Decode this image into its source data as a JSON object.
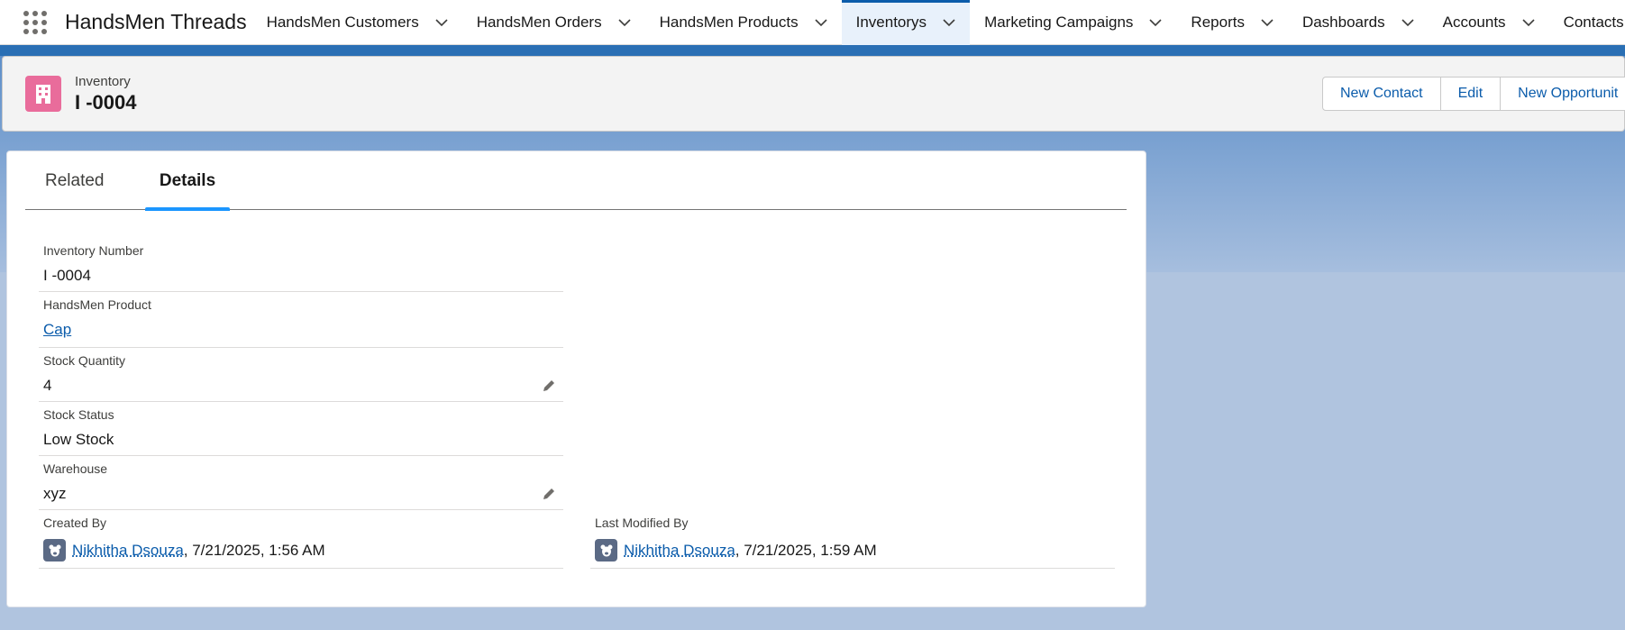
{
  "app": {
    "name": "HandsMen Threads"
  },
  "nav": {
    "items": [
      {
        "label": "HandsMen Customers"
      },
      {
        "label": "HandsMen Orders"
      },
      {
        "label": "HandsMen Products"
      },
      {
        "label": "Inventorys",
        "active": true
      },
      {
        "label": "Marketing Campaigns"
      },
      {
        "label": "Reports"
      },
      {
        "label": "Dashboards"
      },
      {
        "label": "Accounts"
      },
      {
        "label": "Contacts"
      }
    ]
  },
  "header": {
    "object_label": "Inventory",
    "record_title": "I -0004",
    "icon": "building-icon",
    "icon_color": "#e96c9b",
    "actions": [
      "New Contact",
      "Edit",
      "New Opportunit"
    ]
  },
  "tabs": [
    {
      "label": "Related"
    },
    {
      "label": "Details",
      "active": true
    }
  ],
  "details": {
    "inventory_number": {
      "label": "Inventory Number",
      "value": "I -0004"
    },
    "product": {
      "label": "HandsMen Product",
      "value": "Cap"
    },
    "stock_quantity": {
      "label": "Stock Quantity",
      "value": "4"
    },
    "stock_status": {
      "label": "Stock Status",
      "value": "Low Stock"
    },
    "warehouse": {
      "label": "Warehouse",
      "value": "xyz"
    },
    "created_by": {
      "label": "Created By",
      "user": "Nikhitha Dsouza",
      "date": ", 7/21/2025, 1:56 AM"
    },
    "last_modified_by": {
      "label": "Last Modified By",
      "user": "Nikhitha Dsouza",
      "date": ", 7/21/2025, 1:59 AM"
    }
  },
  "colors": {
    "accent": "#0b5cab",
    "tab_active": "#1b96ff",
    "brand_strip": "#2a6fb4"
  }
}
